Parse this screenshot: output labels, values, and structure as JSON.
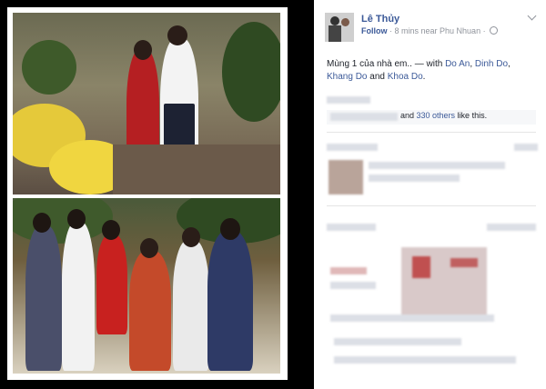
{
  "post": {
    "author": "Lê Thủy",
    "follow": "Follow",
    "time": "· 8 mins near Phu Nhuan ·",
    "status_text": "Mùng 1 của nhà em.. — with ",
    "tags": [
      "Do An",
      "Dinh Do",
      "Khang Do",
      "Khoa Do"
    ],
    "tag_sep1": ", ",
    "tag_sep2": ", ",
    "tag_and": " and ",
    "tag_end": ".",
    "likes_prefix": "and ",
    "likes_count": "330 others",
    "likes_suffix": " like this."
  },
  "icons": {
    "privacy": "globe-icon",
    "options": "chevron-down-icon"
  }
}
